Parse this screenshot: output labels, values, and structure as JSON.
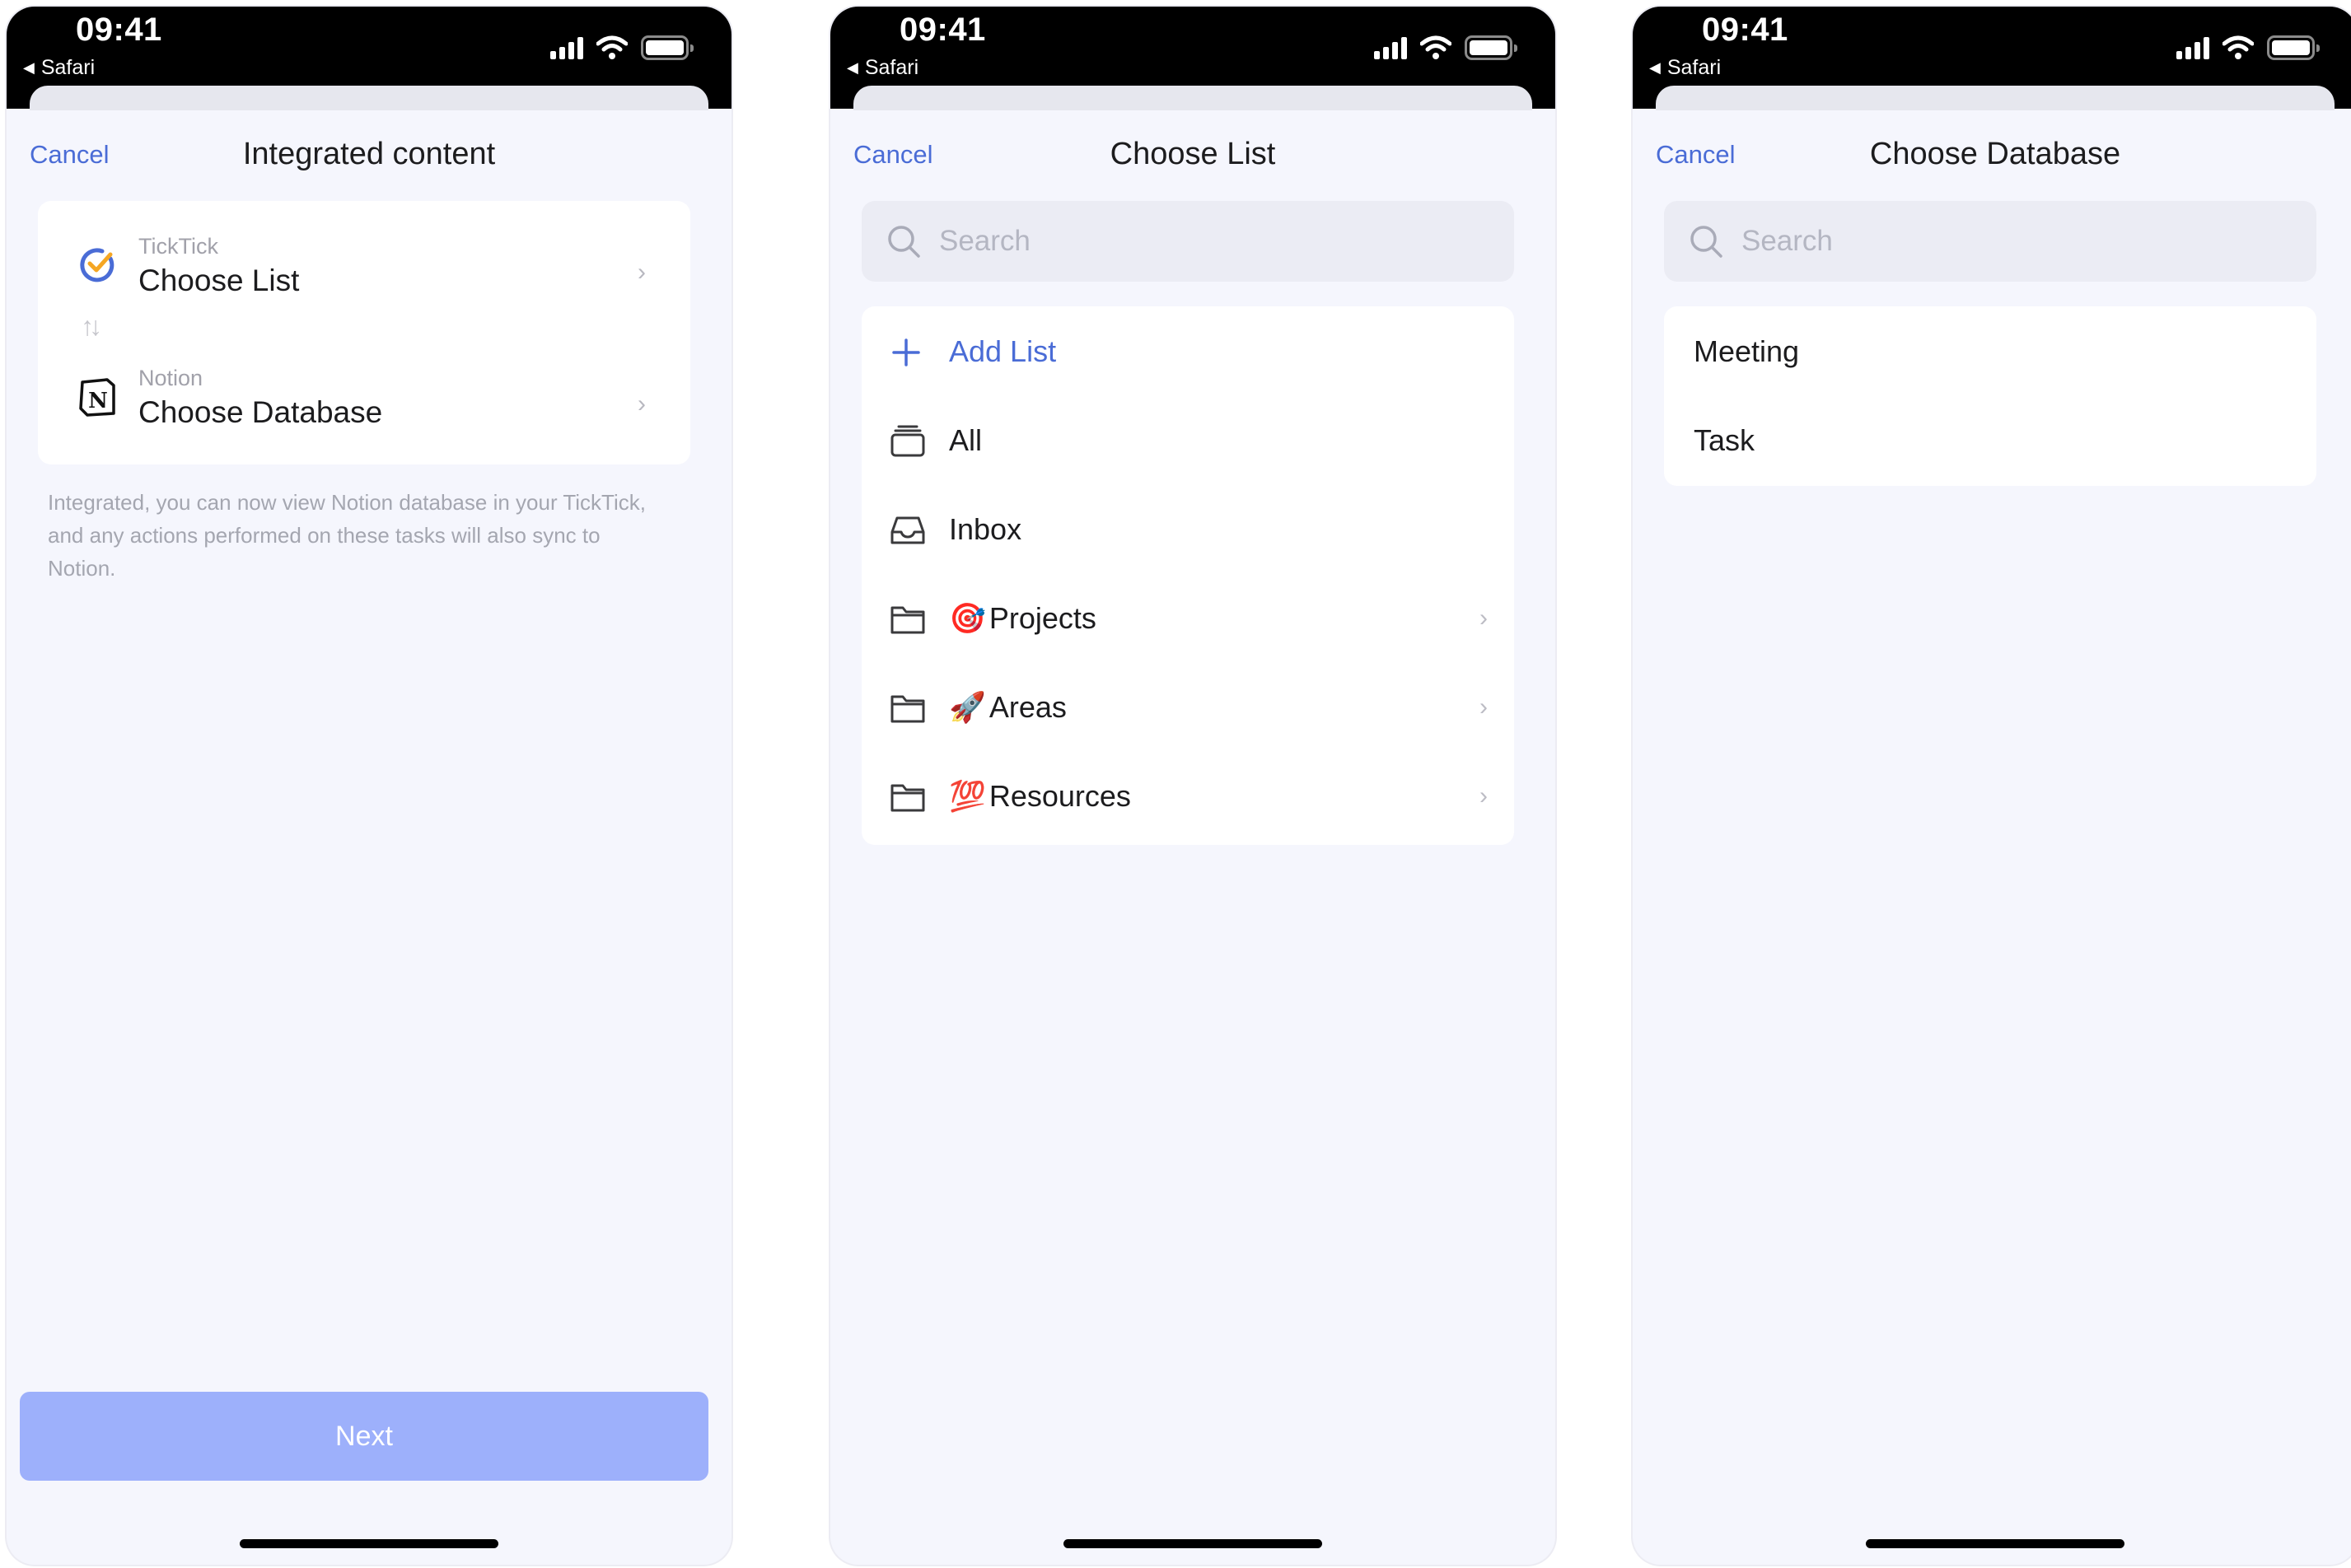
{
  "status_bar": {
    "time": "09:41",
    "back_app": "Safari"
  },
  "screen1": {
    "cancel": "Cancel",
    "title": "Integrated content",
    "ticktick": {
      "label": "TickTick",
      "value": "Choose List"
    },
    "notion": {
      "label": "Notion",
      "value": "Choose Database"
    },
    "info": "Integrated, you can now view Notion database in your TickTick, and any actions performed on these tasks will also sync to Notion.",
    "next": "Next"
  },
  "screen2": {
    "cancel": "Cancel",
    "title": "Choose List",
    "search_placeholder": "Search",
    "add_list": "Add List",
    "items": [
      {
        "label": "All",
        "icon": "stack-icon"
      },
      {
        "label": "Inbox",
        "icon": "inbox-icon"
      },
      {
        "label": "Projects",
        "emoji": "🎯",
        "icon": "folder-icon"
      },
      {
        "label": "Areas",
        "emoji": "🚀",
        "icon": "folder-icon"
      },
      {
        "label": "Resources",
        "emoji": "💯",
        "icon": "folder-icon"
      }
    ]
  },
  "screen3": {
    "cancel": "Cancel",
    "title": "Choose Database",
    "search_placeholder": "Search",
    "items": [
      "Meeting",
      "Task"
    ]
  },
  "colors": {
    "accent": "#4a6cd6",
    "next_button": "#9db0fb",
    "background": "#f5f6fd"
  }
}
